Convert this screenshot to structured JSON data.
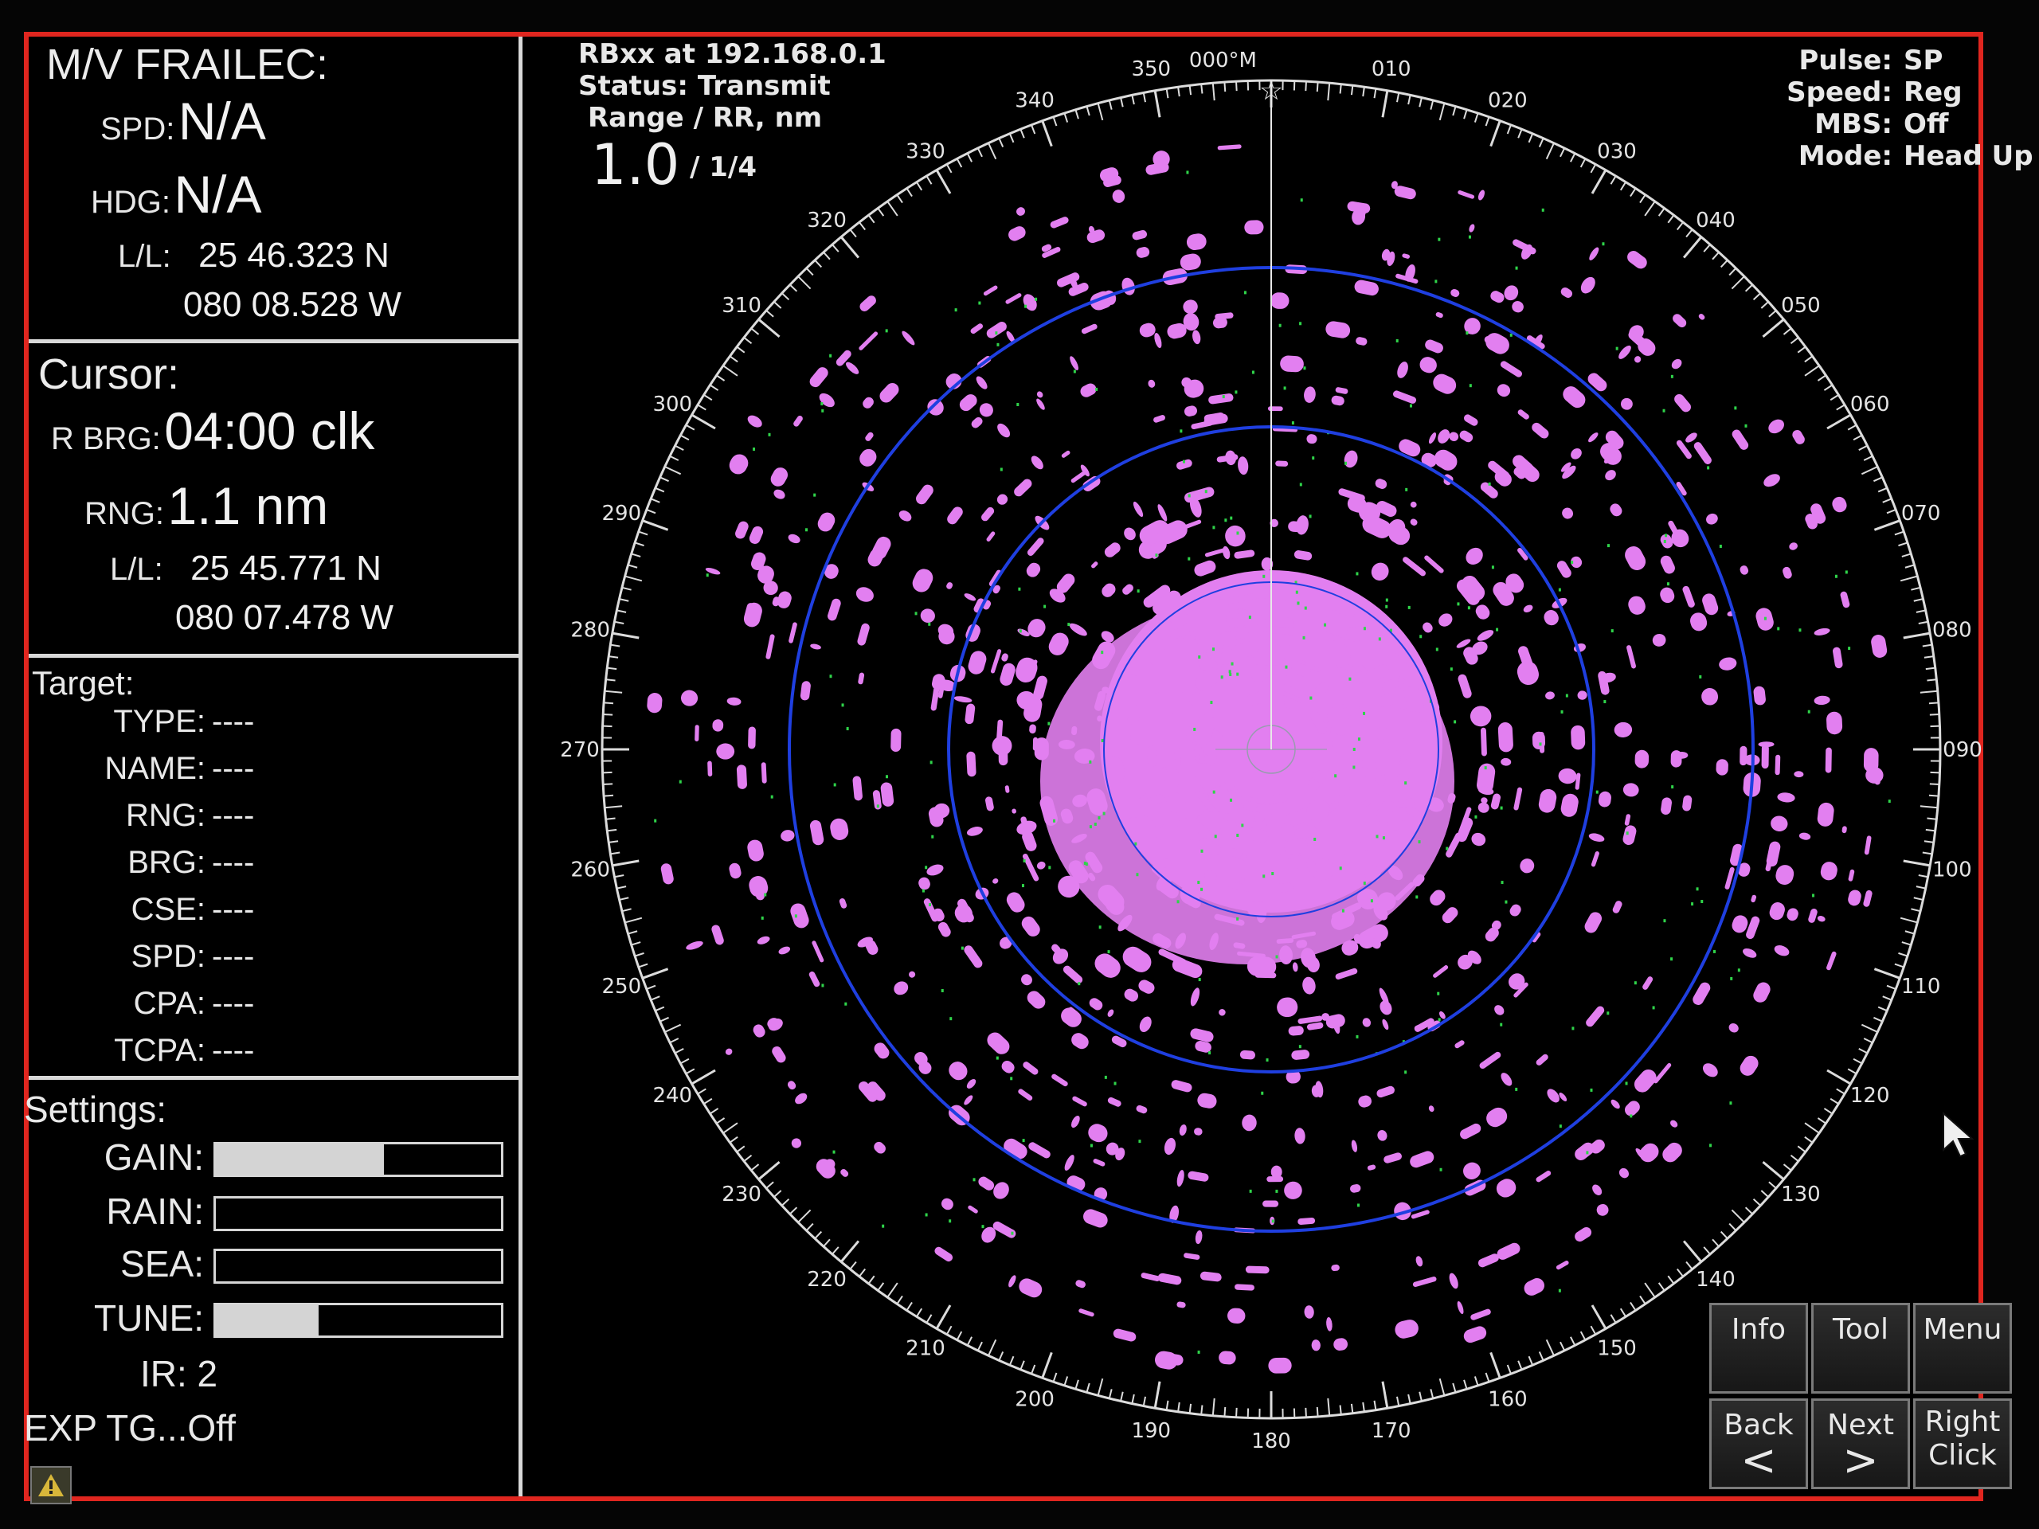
{
  "vessel": {
    "name": "M/V FRAILEC:",
    "spd_label": "SPD:",
    "spd_value": "N/A",
    "hdg_label": "HDG:",
    "hdg_value": "N/A",
    "ll_label": "L/L:",
    "lat": "25 46.323 N",
    "lon": "080 08.528 W"
  },
  "cursor": {
    "title": "Cursor:",
    "rbrg_label": "R BRG:",
    "rbrg_value": "04:00 clk",
    "rng_label": "RNG:",
    "rng_value": "1.1 nm",
    "ll_label": "L/L:",
    "lat": "25 45.771 N",
    "lon": "080 07.478 W"
  },
  "target": {
    "title": "Target:",
    "fields": [
      {
        "label": "TYPE:",
        "value": "----"
      },
      {
        "label": "NAME:",
        "value": "----"
      },
      {
        "label": "RNG:",
        "value": "----"
      },
      {
        "label": "BRG:",
        "value": "----"
      },
      {
        "label": "CSE:",
        "value": "----"
      },
      {
        "label": "SPD:",
        "value": "----"
      },
      {
        "label": "CPA:",
        "value": "----"
      },
      {
        "label": "TCPA:",
        "value": "----"
      }
    ]
  },
  "settings": {
    "title": "Settings:",
    "gain_label": "GAIN:",
    "gain_level": 0.59,
    "rain_label": "RAIN:",
    "rain_level": 0.0,
    "sea_label": "SEA:",
    "sea_level": 0.0,
    "tune_label": "TUNE:",
    "tune_level": 0.36,
    "ir_text": "IR: 2",
    "exp_text": "EXP TG...Off"
  },
  "header": {
    "device": "RBxx at 192.168.0.1",
    "status": "Status:  Transmit",
    "range_label": "Range  /  RR, nm",
    "range_value": "1.0",
    "range_ring": "/ 1/4"
  },
  "modes": [
    {
      "label": "Pulse:",
      "value": "SP"
    },
    {
      "label": "Speed:",
      "value": "Reg"
    },
    {
      "label": "MBS:",
      "value": "Off"
    },
    {
      "label": "Mode:",
      "value": "Head Up"
    }
  ],
  "buttons": {
    "info": "Info",
    "tool": "Tool",
    "menu": "Menu",
    "back": "Back",
    "back_arrow": "<",
    "next": "Next",
    "next_arrow": ">",
    "right_click_1": "Right",
    "right_click_2": "Click"
  },
  "compass": {
    "north_label": "000°M",
    "labels": [
      "010",
      "020",
      "030",
      "040",
      "050",
      "060",
      "070",
      "080",
      "090",
      "100",
      "110",
      "120",
      "130",
      "140",
      "150",
      "160",
      "170",
      "180",
      "190",
      "200",
      "210",
      "220",
      "230",
      "240",
      "250",
      "260",
      "270",
      "280",
      "290",
      "300",
      "310",
      "320",
      "330",
      "340",
      "350"
    ]
  },
  "colors": {
    "frame": "#e0261f",
    "echo": "#e27ff0",
    "ring": "#1f3fe0",
    "scale": "#dcdcdc",
    "noise": "#2fd44a"
  }
}
